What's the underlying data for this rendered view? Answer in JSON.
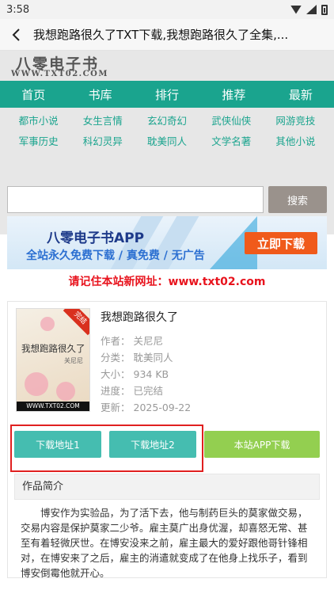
{
  "status": {
    "time": "3:58"
  },
  "header": {
    "title": "我想跑路很久了TXT下载,我想跑路很久了全集,..."
  },
  "logo": {
    "name": "八零电子书",
    "domain": "WWW.TXT02.COM"
  },
  "nav": [
    "首页",
    "书库",
    "排行",
    "推荐",
    "最新"
  ],
  "categories": [
    [
      "都市小说",
      "女生言情",
      "玄幻奇幻",
      "武侠仙侠",
      "网游竞技"
    ],
    [
      "军事历史",
      "科幻灵异",
      "耽美同人",
      "文学名著",
      "其他小说"
    ]
  ],
  "search": {
    "placeholder": "",
    "button": "搜索"
  },
  "banner": {
    "title": "八零电子书APP",
    "subtitle": "全站永久免费下载 / 真免费 / 无广告",
    "button": "立即下载"
  },
  "notice": "请记住本站新网址：www.txt02.com",
  "book": {
    "cover_title": "我想跑路很久了",
    "cover_author": "关尼尼",
    "cover_badge": "完结",
    "cover_site": "WWW.TXT02.COM",
    "name": "我想跑路很久了",
    "author_label": "作者：",
    "author": "关尼尼",
    "category_label": "分类：",
    "category": "耽美同人",
    "size_label": "大小：",
    "size": "934 KB",
    "progress_label": "进度：",
    "progress": "已完结",
    "updated_label": "更新：",
    "updated": "2025-09-22"
  },
  "actions": {
    "download1": "下载地址1",
    "download2": "下载地址2",
    "app_download": "本站APP下载"
  },
  "intro": {
    "heading": "作品简介",
    "text": "博安作为实验品，为了活下去，他与制药巨头的莫家做交易，交易内容是保护莫家二少爷。雇主莫广出身优渥，却喜怒无常、甚至有着轻微厌世。在博安没来之前，雇主最大的爱好跟他哥针锋相对，在博安来了之后，雇主的消遣就变成了在他身上找乐子，看到博安倒霉他就开心。"
  },
  "colors": {
    "accent": "#1aa48e",
    "download": "#45bdb0",
    "app": "#93cf50",
    "notice": "#e8131d"
  }
}
